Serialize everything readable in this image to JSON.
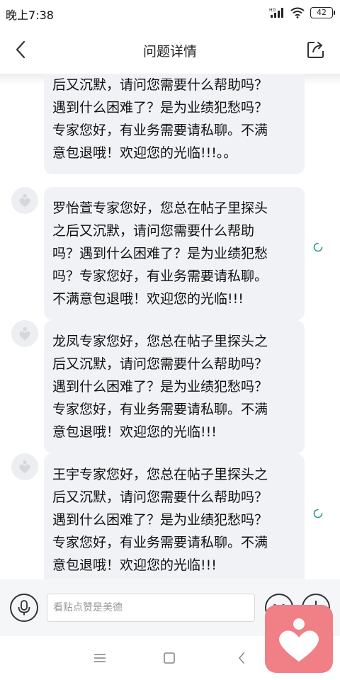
{
  "status_bar": {
    "time": "晚上7:38",
    "network": "HD",
    "battery": "42"
  },
  "header": {
    "title": "问题详情"
  },
  "messages": [
    {
      "text": "后又沉默，请问您需要什么帮助吗？\n遇到什么困难了？是为业绩犯愁吗？\n专家您好，有业务需要请私聊。不满\n意包退哦！欢迎您的光临!!!。。"
    },
    {
      "text": "罗怡萱专家您好，您总在帖子里探头\n之后又沉默，请问您需要什么帮助\n吗？遇到什么困难了？是为业绩犯愁\n吗？专家您好，有业务需要请私聊。\n不满意包退哦！欢迎您的光临!!!"
    },
    {
      "text": "龙凤专家您好，您总在帖子里探头之\n后又沉默，请问您需要什么帮助吗？\n遇到什么困难了？是为业绩犯愁吗？\n专家您好，有业务需要请私聊。不满\n意包退哦！欢迎您的光临!!!"
    },
    {
      "text": "王宇专家您好，您总在帖子里探头之\n后又沉默，请问您需要什么帮助吗？\n遇到什么困难了？是为业绩犯愁吗？\n专家您好，有业务需要请私聊。不满\n意包退哦！欢迎您的光临!!!"
    }
  ],
  "input": {
    "placeholder": "看贴点赞是美德"
  },
  "colors": {
    "bubble_bg": "#f1f2f6",
    "fab": "#f07f86",
    "spinner": "#2a9d8f"
  }
}
